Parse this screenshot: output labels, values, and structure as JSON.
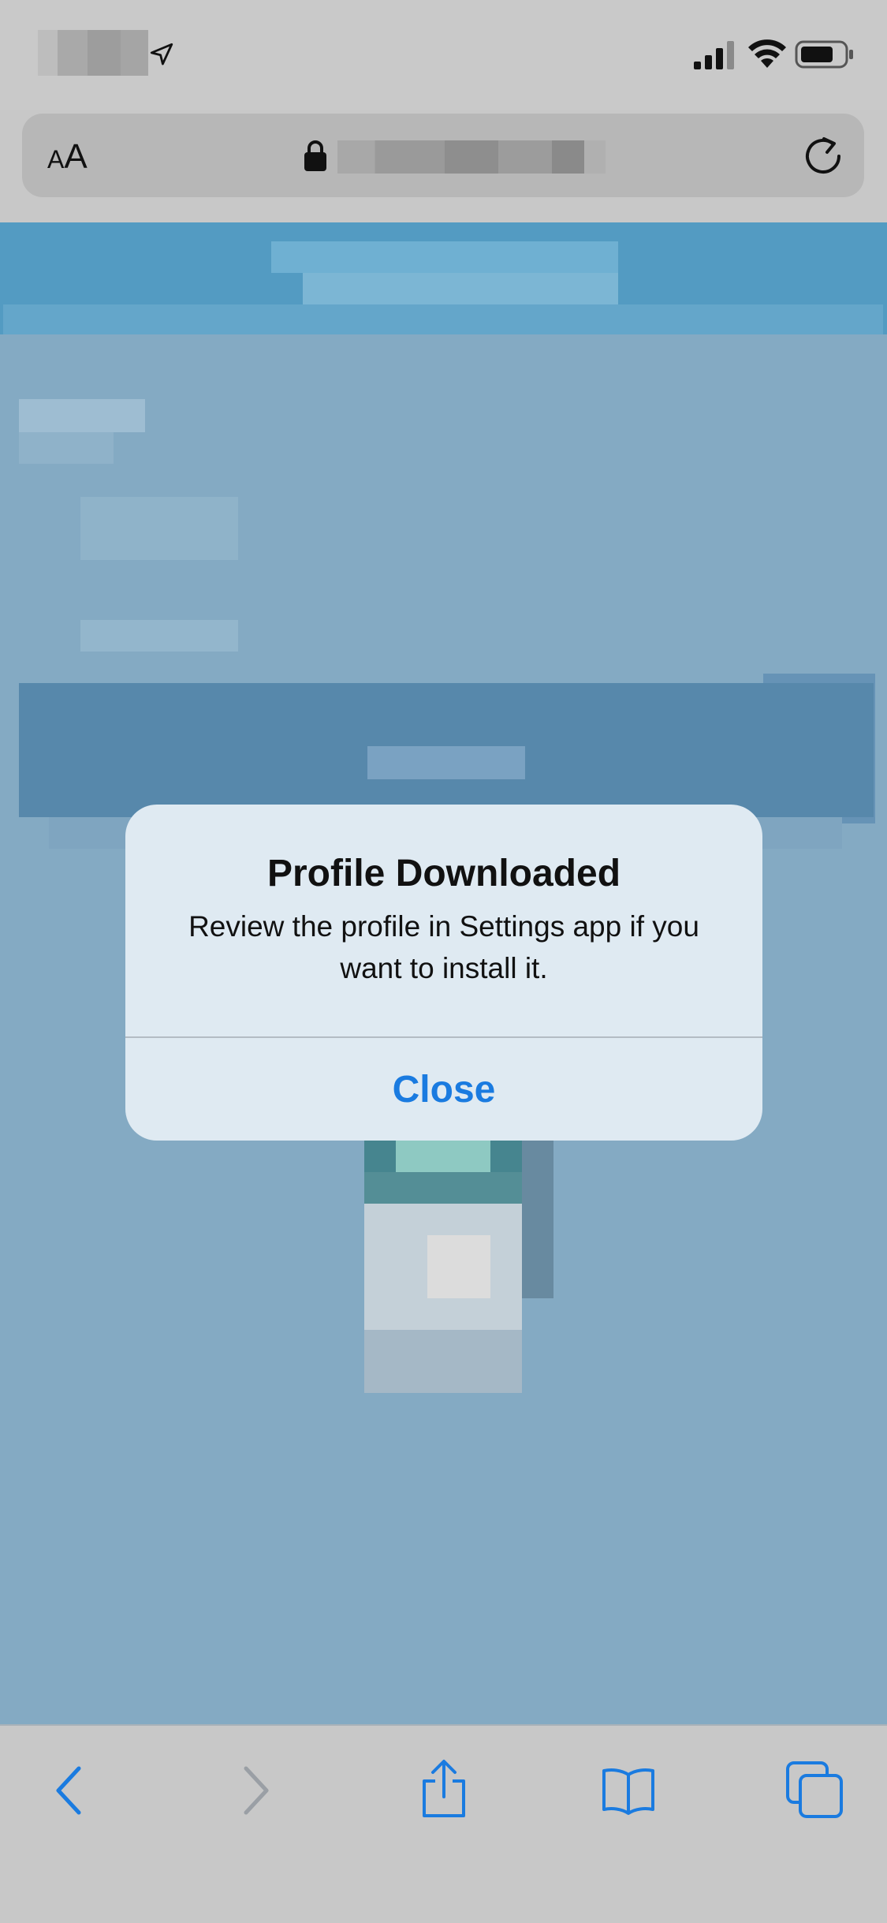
{
  "status_bar": {
    "icons": [
      "location-arrow-icon",
      "cellular-signal-icon",
      "wifi-icon",
      "battery-icon"
    ]
  },
  "address_bar": {
    "text_size_label_small": "A",
    "text_size_label_large": "A",
    "icons": [
      "lock-icon",
      "reload-icon"
    ]
  },
  "alert": {
    "title": "Profile Downloaded",
    "message": "Review the profile in Settings app if you want to install it.",
    "close_label": "Close"
  },
  "toolbar": {
    "icons": [
      "back-icon",
      "forward-icon",
      "share-icon",
      "bookmarks-icon",
      "tabs-icon"
    ]
  },
  "colors": {
    "accent": "#1a7be0",
    "page_background": "#84aac3",
    "header": "#539bc2",
    "alert_background": "#dfeaf2",
    "chrome_background": "#c8c8c8"
  }
}
